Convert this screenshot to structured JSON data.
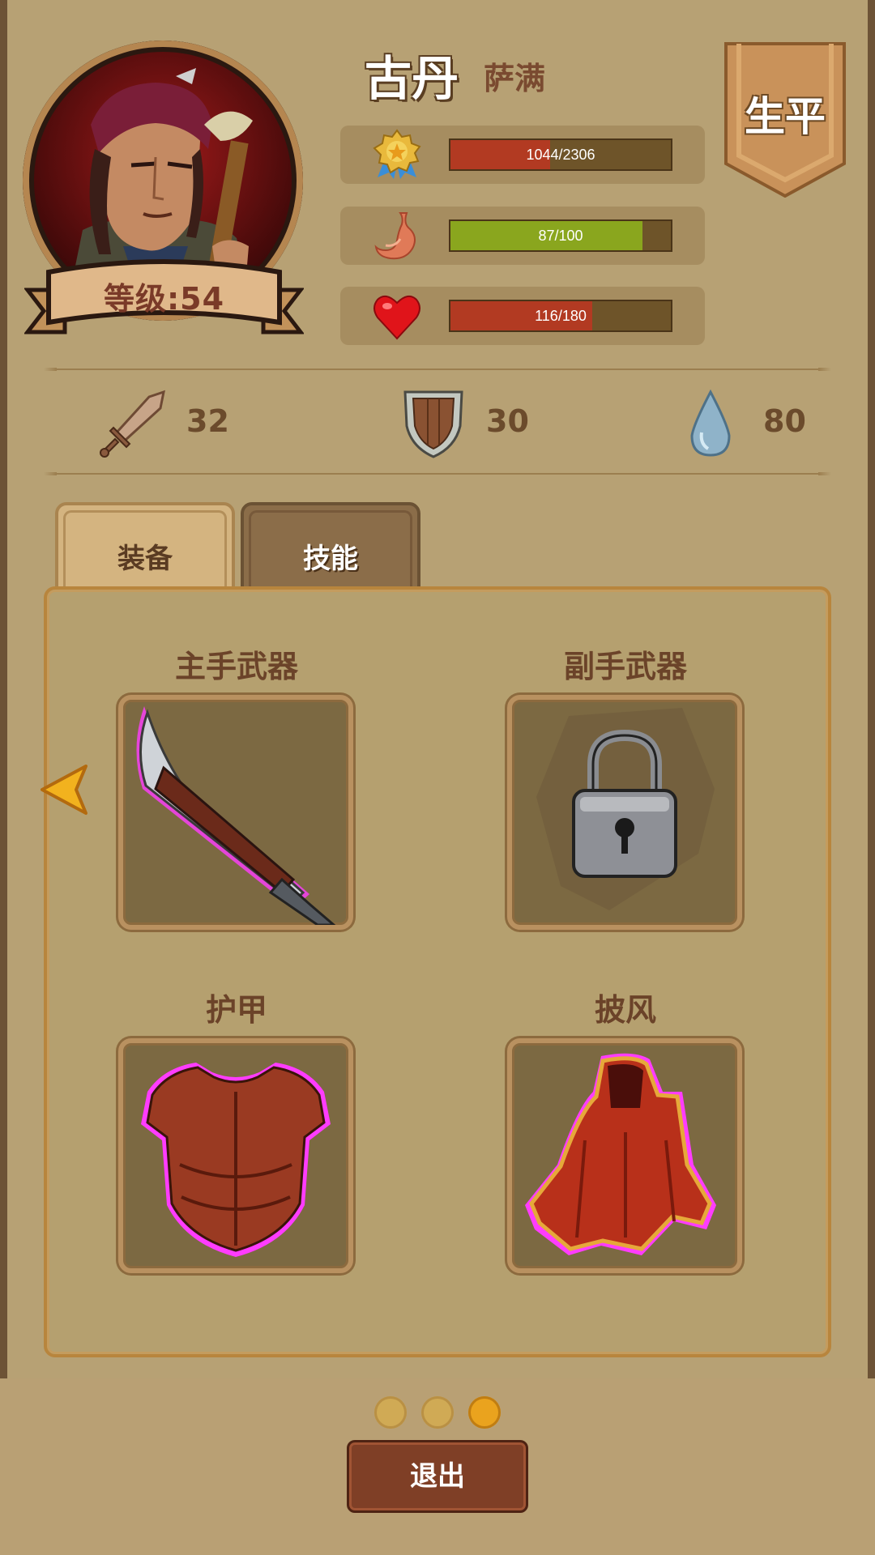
{
  "hero": {
    "name": "古丹",
    "job": "萨满",
    "level_label": "等级:54",
    "profile_label": "生平"
  },
  "stats": {
    "exp": {
      "text": "1044/2306",
      "current": 1044,
      "max": 2306,
      "color": "#b23a22"
    },
    "hunger": {
      "text": "87/100",
      "current": 87,
      "max": 100,
      "color": "#8aa61e"
    },
    "health": {
      "text": "116/180",
      "current": 116,
      "max": 180,
      "color": "#b23a22"
    }
  },
  "attributes": {
    "attack": "32",
    "defense": "30",
    "mana": "80"
  },
  "tabs": {
    "equipment": "装备",
    "skills": "技能",
    "active": "equipment"
  },
  "slots": {
    "main_weapon": {
      "title": "主手武器",
      "item": "curved-blade-icon"
    },
    "off_weapon": {
      "title": "副手武器",
      "item": "lock-icon"
    },
    "armor": {
      "title": "护甲",
      "item": "chest-armor-icon"
    },
    "cloak": {
      "title": "披风",
      "item": "cloak-icon"
    }
  },
  "pager": {
    "pages": 3,
    "current": 3
  },
  "exit_label": "退出"
}
